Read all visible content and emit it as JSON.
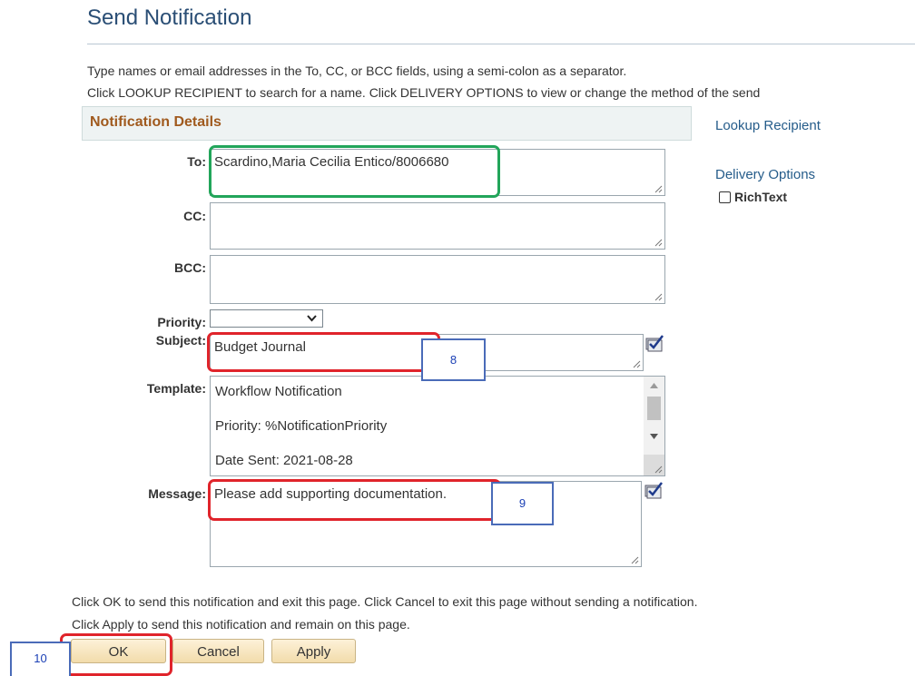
{
  "page": {
    "title": "Send Notification",
    "instructions": [
      "Type names or email addresses in the To, CC, or BCC fields, using a semi-colon as a separator.",
      "Click LOOKUP RECIPIENT to search for a name.  Click DELIVERY OPTIONS to view or change the method of the send"
    ]
  },
  "section": {
    "title": "Notification Details"
  },
  "side_links": {
    "lookup": "Lookup Recipient",
    "delivery": "Delivery Options",
    "richtext": "RichText"
  },
  "form": {
    "to_label": "To:",
    "to_value": "Scardino,Maria Cecilia Entico/8006680",
    "cc_label": "CC:",
    "cc_value": "",
    "bcc_label": "BCC:",
    "bcc_value": "",
    "priority_label": "Priority:",
    "priority_value": "",
    "subject_label": "Subject:",
    "subject_value": "Budget Journal",
    "template_label": "Template:",
    "template_lines": [
      "Workflow Notification",
      "Priority:  %NotificationPriority",
      "Date Sent:  2021-08-28"
    ],
    "message_label": "Message:",
    "message_value": "Please add supporting documentation."
  },
  "footer": {
    "lines": [
      "Click OK to send this notification and exit this page.  Click Cancel to exit this page without sending a notification.",
      "Click Apply to send this notification and remain on this page."
    ],
    "ok": "OK",
    "cancel": "Cancel",
    "apply": "Apply"
  },
  "callouts": {
    "subject": "8",
    "message": "9",
    "ok": "10"
  },
  "colors": {
    "title": "#2a4e75",
    "section_title": "#a05a1e",
    "link": "#255c8a",
    "highlight_red": "#e0242b",
    "highlight_green": "#22a55a",
    "callout_border": "#4a6bb8"
  },
  "icons": {
    "spell_check": "spell-check-icon",
    "resize": "resize-grip-icon",
    "dropdown": "chevron-down-icon"
  }
}
